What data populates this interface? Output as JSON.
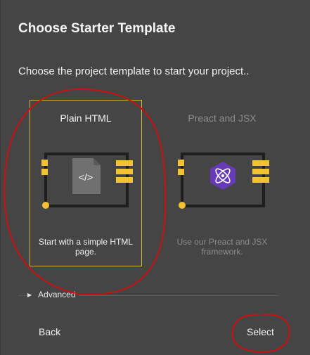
{
  "dialog": {
    "title": "Choose Starter Template",
    "subtitle": "Choose the project template to start your project.."
  },
  "templates": [
    {
      "title": "Plain HTML",
      "description": "Start with a simple HTML page.",
      "icon": "html-file-icon",
      "selected": true
    },
    {
      "title": "Preact and JSX",
      "description": "Use our Preact and JSX framework.",
      "icon": "preact-atom-icon",
      "selected": false
    }
  ],
  "advanced": {
    "label": "Advanced",
    "icon": "caret-right-icon"
  },
  "footer": {
    "back_label": "Back",
    "select_label": "Select"
  },
  "colors": {
    "background": "#454545",
    "accent_yellow": "#f2c230",
    "selected_border": "#d6b43a",
    "preact_purple": "#673ab8",
    "annotation_red": "#cc1111"
  },
  "html_icon_glyph": "</>"
}
